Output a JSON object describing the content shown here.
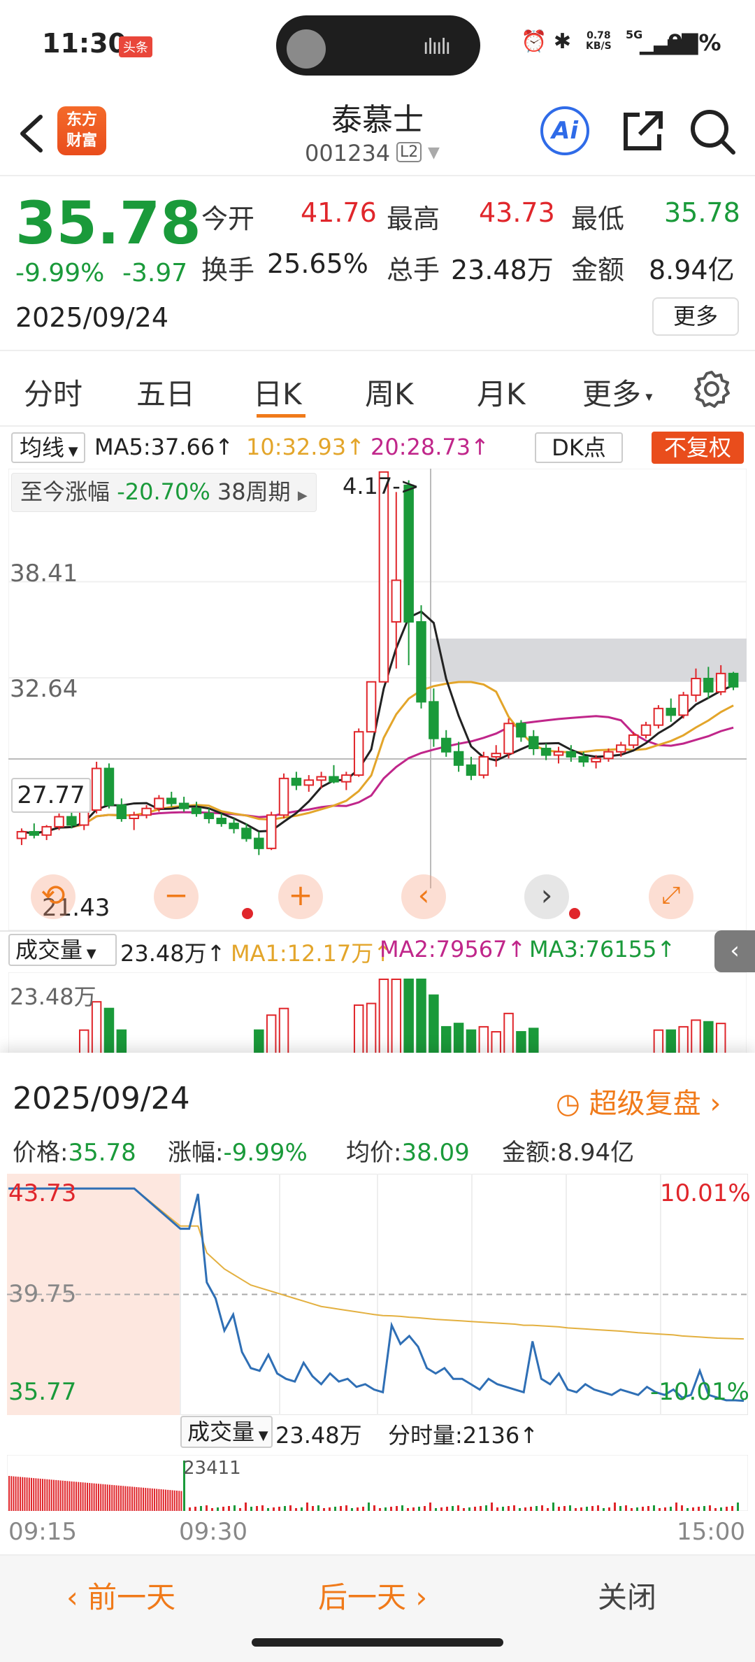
{
  "status_bar": {
    "time": "11:30",
    "app_badge": "头条",
    "network_speed": "0.78\nKB/S",
    "network_type": "5G",
    "battery": "91%"
  },
  "header": {
    "stock_name": "泰慕士",
    "stock_code": "001234",
    "level_badge": "L2",
    "logo_text": "东方\n财富",
    "ai_label": "Ai"
  },
  "quote": {
    "price": "35.78",
    "change_pct": "-9.99%",
    "change_abs": "-3.97",
    "date": "2025/09/24",
    "open_label": "今开",
    "open_value": "41.76",
    "high_label": "最高",
    "high_value": "43.73",
    "low_label": "最低",
    "low_value": "35.78",
    "turnover_label": "换手",
    "turnover_value": "25.65%",
    "volume_label": "总手",
    "volume_value": "23.48万",
    "amount_label": "金额",
    "amount_value": "8.94亿",
    "more_button": "更多"
  },
  "tabs": {
    "items": [
      "分时",
      "五日",
      "日K",
      "周K",
      "月K",
      "更多"
    ],
    "active": "日K"
  },
  "ma_bar": {
    "select": "均线",
    "ma5": "MA5:37.66↑",
    "ma10": "10:32.93↑",
    "ma20": "20:28.73↑",
    "dk": "DK点",
    "fuquan": "不复权"
  },
  "kline": {
    "summary_label": "至今涨幅",
    "summary_value": "-20.70%",
    "summary_period": "38周期",
    "peak_annotation": "4.17->",
    "y_labels": [
      "38.41",
      "32.64",
      "27.77"
    ],
    "low_label": "21.43",
    "chart_data": {
      "type": "candlestick",
      "ylim": [
        20.0,
        45.2
      ],
      "candles": [
        [
          23.0,
          23.6,
          22.6,
          23.4
        ],
        [
          23.4,
          23.9,
          23.0,
          23.2
        ],
        [
          23.2,
          23.8,
          22.9,
          23.7
        ],
        [
          23.7,
          24.5,
          23.5,
          24.3
        ],
        [
          24.3,
          24.6,
          23.6,
          23.8
        ],
        [
          23.8,
          24.9,
          23.5,
          24.7
        ],
        [
          24.7,
          27.6,
          24.5,
          27.2
        ],
        [
          27.2,
          27.5,
          24.8,
          25.0
        ],
        [
          25.0,
          25.4,
          24.0,
          24.2
        ],
        [
          24.2,
          24.6,
          23.5,
          24.4
        ],
        [
          24.4,
          25.0,
          24.2,
          24.8
        ],
        [
          24.8,
          25.6,
          24.6,
          25.4
        ],
        [
          25.4,
          25.8,
          24.9,
          25.1
        ],
        [
          25.1,
          25.5,
          24.6,
          24.8
        ],
        [
          24.8,
          25.2,
          24.3,
          24.5
        ],
        [
          24.5,
          24.8,
          23.9,
          24.2
        ],
        [
          24.2,
          24.5,
          23.7,
          23.9
        ],
        [
          23.9,
          24.2,
          23.3,
          23.6
        ],
        [
          23.6,
          23.9,
          22.8,
          23.0
        ],
        [
          23.0,
          23.4,
          22.0,
          22.4
        ],
        [
          22.4,
          24.6,
          22.3,
          24.4
        ],
        [
          24.4,
          26.9,
          24.2,
          26.6
        ],
        [
          26.6,
          27.0,
          25.9,
          26.2
        ],
        [
          26.2,
          26.8,
          25.8,
          26.5
        ],
        [
          26.5,
          27.0,
          26.0,
          26.7
        ],
        [
          26.7,
          27.4,
          26.3,
          26.4
        ],
        [
          26.4,
          27.0,
          25.9,
          26.8
        ],
        [
          26.8,
          29.6,
          26.7,
          29.4
        ],
        [
          29.4,
          32.4,
          29.4,
          32.4
        ],
        [
          32.4,
          45.0,
          32.4,
          45.0
        ],
        [
          36.0,
          43.8,
          33.2,
          38.5
        ],
        [
          44.2,
          44.5,
          33.4,
          36.0
        ],
        [
          36.0,
          37.0,
          30.8,
          31.2
        ],
        [
          31.2,
          32.0,
          28.5,
          29.0
        ],
        [
          29.0,
          29.5,
          27.9,
          28.2
        ],
        [
          28.2,
          28.8,
          27.0,
          27.4
        ],
        [
          27.4,
          27.9,
          26.5,
          26.8
        ],
        [
          26.8,
          28.2,
          26.6,
          27.9
        ],
        [
          27.9,
          28.6,
          27.3,
          28.1
        ],
        [
          28.1,
          30.2,
          27.8,
          29.9
        ],
        [
          29.9,
          30.1,
          28.8,
          29.1
        ],
        [
          29.1,
          29.5,
          28.0,
          28.4
        ],
        [
          28.4,
          28.7,
          27.7,
          28.0
        ],
        [
          28.0,
          28.5,
          27.5,
          28.2
        ],
        [
          28.2,
          28.6,
          27.6,
          27.9
        ],
        [
          27.9,
          28.2,
          27.3,
          27.6
        ],
        [
          27.6,
          28.0,
          27.2,
          27.8
        ],
        [
          27.8,
          28.4,
          27.6,
          28.2
        ],
        [
          28.2,
          28.8,
          27.9,
          28.6
        ],
        [
          28.6,
          29.4,
          28.4,
          29.2
        ],
        [
          29.2,
          30.0,
          29.0,
          29.8
        ],
        [
          29.8,
          31.0,
          29.6,
          30.8
        ],
        [
          30.8,
          31.4,
          30.0,
          30.4
        ],
        [
          30.4,
          31.8,
          30.2,
          31.6
        ],
        [
          31.6,
          33.2,
          31.2,
          32.6
        ],
        [
          32.6,
          33.3,
          31.4,
          31.8
        ],
        [
          31.8,
          33.4,
          31.6,
          32.9
        ],
        [
          32.9,
          33.0,
          31.9,
          32.1
        ]
      ]
    }
  },
  "volume_bar": {
    "select": "成交量",
    "value": "23.48万↑",
    "ma1": "MA1:12.17万↑",
    "ma2": "MA2:79567↑",
    "ma3": "MA3:76155↑",
    "y_label": "23.48万"
  },
  "intraday": {
    "date": "2025/09/24",
    "review_link": "超级复盘",
    "price_label": "价格:",
    "price_value": "35.78",
    "change_label": "涨幅:",
    "change_value": "-9.99%",
    "avg_label": "均价:",
    "avg_value": "38.09",
    "amount_label": "金额:",
    "amount_value": "8.94亿",
    "high_label": "43.73",
    "mid_label": "39.75",
    "low_label": "35.77",
    "high_pct": "10.01%",
    "low_pct": "-10.01%",
    "vol_select": "成交量",
    "vol_value": "23.48万",
    "tick_vol_label": "分时量:",
    "tick_vol_value": "2136↑",
    "vol_max_label": "23411",
    "time_start": "09:15",
    "time_open": "09:30",
    "time_end": "15:00",
    "chart_data": {
      "type": "line",
      "ylim": [
        35.77,
        43.73
      ],
      "price_series": [
        43.7,
        43.7,
        43.7,
        43.7,
        42.2,
        42.2,
        43.5,
        40.2,
        39.6,
        38.4,
        39.0,
        37.6,
        37.0,
        36.9,
        37.5,
        36.8,
        36.6,
        36.5,
        37.2,
        36.7,
        36.4,
        36.8,
        36.5,
        36.6,
        36.3,
        36.4,
        36.2,
        36.1,
        38.6,
        37.9,
        38.2,
        37.8,
        37.0,
        36.8,
        37.0,
        36.6,
        36.6,
        36.4,
        36.2,
        36.6,
        36.4,
        36.3,
        36.2,
        36.1,
        38.0,
        36.6,
        36.4,
        36.8,
        36.2,
        36.1,
        36.4,
        36.2,
        36.1,
        36.0,
        36.2,
        36.1,
        36.0,
        36.3,
        36.1,
        36.0,
        36.2,
        35.9,
        36.0,
        36.9,
        36.0,
        35.9,
        35.8,
        35.8,
        35.78
      ],
      "avg_series": [
        43.7,
        43.7,
        43.7,
        43.7,
        42.3,
        42.3,
        42.3,
        41.3,
        41.0,
        40.7,
        40.5,
        40.3,
        40.1,
        40.0,
        39.9,
        39.8,
        39.7,
        39.6,
        39.5,
        39.4,
        39.3,
        39.25,
        39.2,
        39.15,
        39.1,
        39.05,
        39.0,
        38.96,
        38.95,
        38.93,
        38.9,
        38.88,
        38.85,
        38.82,
        38.8,
        38.78,
        38.76,
        38.74,
        38.72,
        38.7,
        38.68,
        38.66,
        38.64,
        38.6,
        38.6,
        38.58,
        38.56,
        38.54,
        38.5,
        38.48,
        38.46,
        38.44,
        38.42,
        38.4,
        38.38,
        38.35,
        38.32,
        38.3,
        38.28,
        38.26,
        38.24,
        38.2,
        38.18,
        38.16,
        38.14,
        38.12,
        38.11,
        38.1,
        38.09
      ]
    }
  },
  "bottom": {
    "prev": "前一天",
    "next": "后一天",
    "close": "关闭"
  },
  "colors": {
    "up": "#e0262b",
    "down": "#1a9a3a",
    "accent": "#f07a1a",
    "ma5": "#222222",
    "ma10": "#e3a52a",
    "ma20": "#c0268a",
    "intraday_line": "#2f6fb5",
    "avg_line": "#e3b040"
  }
}
